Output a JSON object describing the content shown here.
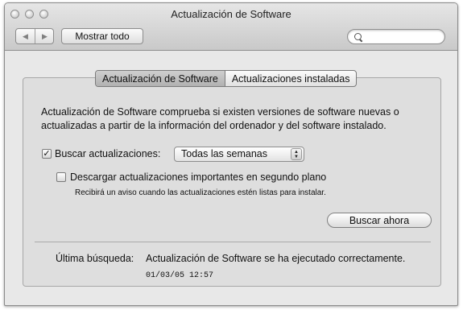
{
  "window": {
    "title": "Actualización de Software"
  },
  "toolbar": {
    "back_icon": "◀",
    "forward_icon": "▶",
    "show_all_label": "Mostrar todo",
    "search": {
      "value": "",
      "placeholder": ""
    }
  },
  "tabs": [
    {
      "label": "Actualización de Software",
      "active": true
    },
    {
      "label": "Actualizaciones instaladas",
      "active": false
    }
  ],
  "main": {
    "description": "Actualización de Software comprueba si existen versiones de software nuevas o actualizadas a partir de la información del ordenador y del software instalado.",
    "check_updates": {
      "checked": true,
      "check_mark": "✓",
      "label": "Buscar actualizaciones:",
      "frequency": "Todas las semanas"
    },
    "background_download": {
      "checked": false,
      "label": "Descargar actualizaciones importantes en segundo plano",
      "note": "Recibirá un aviso cuando las actualizaciones estén listas para instalar."
    },
    "check_now_label": "Buscar ahora",
    "last_check": {
      "label": "Última búsqueda:",
      "message": "Actualización de Software se ha ejecutado correctamente.",
      "date": "01/03/05 12:57"
    }
  }
}
